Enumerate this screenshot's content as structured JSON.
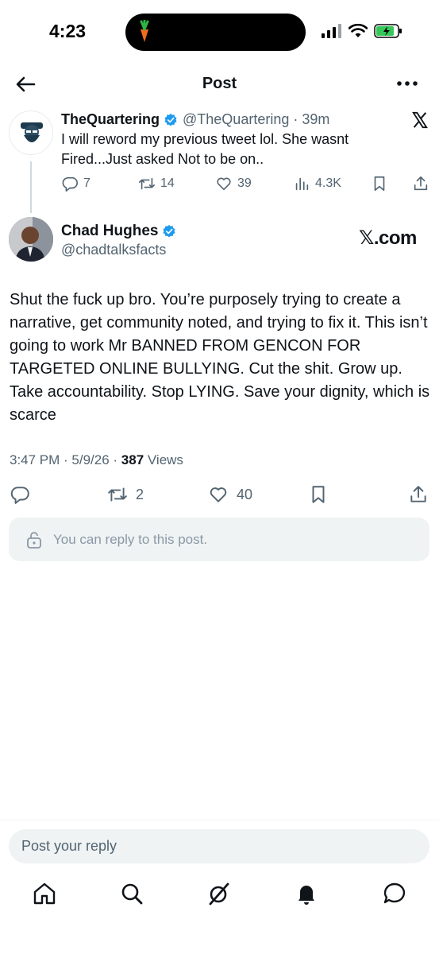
{
  "status_bar": {
    "time": "4:23"
  },
  "header": {
    "title": "Post"
  },
  "quoted_tweet": {
    "name": "TheQuartering",
    "handle": "@TheQuartering",
    "age": "39m",
    "text": "I will reword my previous tweet lol.  She wasnt Fired...Just asked Not to be on..",
    "replies": "7",
    "reposts": "14",
    "likes": "39",
    "views": "4.3K"
  },
  "main_tweet": {
    "name": "Chad Hughes",
    "handle": "@chadtalksfacts",
    "source_badge": "𝕏.com",
    "text": "Shut the fuck up bro. You’re purposely trying to create a narrative, get community noted, and trying to fix it. This isn’t going to work Mr BANNED FROM GENCON FOR TARGETED ONLINE BULLYING. Cut the shit. Grow up. Take accountability. Stop LYING. Save your dignity, which is scarce",
    "timestamp": "3:47 PM · 5/9/26 · ",
    "views_count": "387",
    "views_label": " Views",
    "reposts": "2",
    "likes": "40"
  },
  "reply_notice": "You can reply to this post.",
  "reply_box": {
    "placeholder": "Post your reply"
  },
  "colors": {
    "verified": "#1d9bf0",
    "battery": "#34c759",
    "muted": "#536471"
  },
  "icons": [
    "back-arrow-icon",
    "more-icon",
    "verified-badge-icon",
    "x-logo-icon",
    "reply-icon",
    "repost-icon",
    "like-icon",
    "views-icon",
    "bookmark-icon",
    "share-icon",
    "lock-icon",
    "home-icon",
    "search-icon",
    "grok-icon",
    "notifications-icon",
    "messages-icon"
  ]
}
